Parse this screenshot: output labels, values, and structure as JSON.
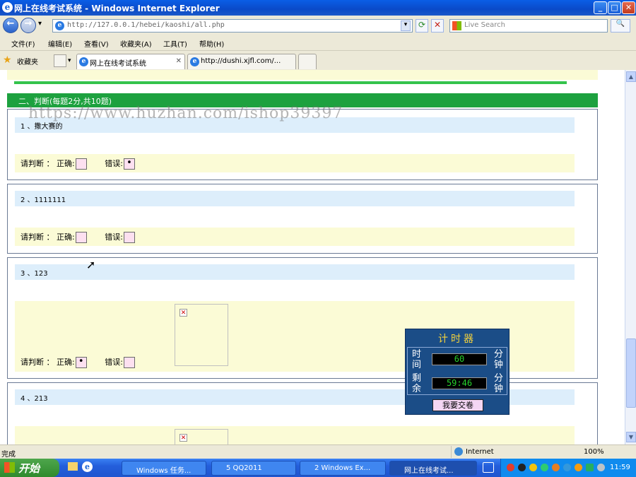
{
  "window": {
    "title": "网上在线考试系统 - Windows Internet Explorer",
    "min": "_",
    "max": "□",
    "close": "✕"
  },
  "toolbar": {
    "address": "http://127.0.0.1/hebei/kaoshi/all.php",
    "search_placeholder": "Live Search",
    "back": "←",
    "forward": "→",
    "refresh": "⟳",
    "stop": "✕",
    "dropdown": "▾",
    "go": "🔍"
  },
  "menu": [
    "文件(F)",
    "编辑(E)",
    "查看(V)",
    "收藏夹(A)",
    "工具(T)",
    "帮助(H)"
  ],
  "favorites": {
    "label": "收藏夹",
    "star": "★"
  },
  "tabs": [
    {
      "label": "网上在线考试系统",
      "close": "✕"
    },
    {
      "label": "http://dushi.xjfl.com/..."
    }
  ],
  "section": {
    "title": "二、判断(每题2分,共10题)"
  },
  "watermark": "https://www.huzhan.com/ishop39397",
  "judge": {
    "prompt": "请判断 ：",
    "correct": "正确:",
    "wrong": "错误:",
    "checked": "•"
  },
  "questions": [
    {
      "title": "1 、撒大赛的",
      "answer": "wrong"
    },
    {
      "title": "2 、1111111",
      "answer": ""
    },
    {
      "title": "3 、123",
      "answer": "correct"
    },
    {
      "title": "4 、213",
      "answer": ""
    }
  ],
  "broken_image": "✕",
  "timer": {
    "title": "计时器",
    "total_label": "时间",
    "remain_label": "剩余",
    "unit": "分钟",
    "total": "60",
    "remaining": "59:46",
    "submit": "我要交卷"
  },
  "statusbar": {
    "text": "完成",
    "zone": "Internet",
    "zoom": "100%"
  },
  "taskbar": {
    "start": "开始",
    "tasks": [
      "Windows 任务...",
      "5 QQ2011",
      "2 Windows Ex...",
      "网上在线考试..."
    ],
    "clock": "11:59"
  },
  "colors": {
    "accent": "#1da13f",
    "title_bar": "#0a5ee6",
    "timer_bg": "#1b4d87",
    "timer_digits": "#27d12c",
    "answer_bg": "#fbfbd6",
    "question_bg": "#ddeefb"
  }
}
